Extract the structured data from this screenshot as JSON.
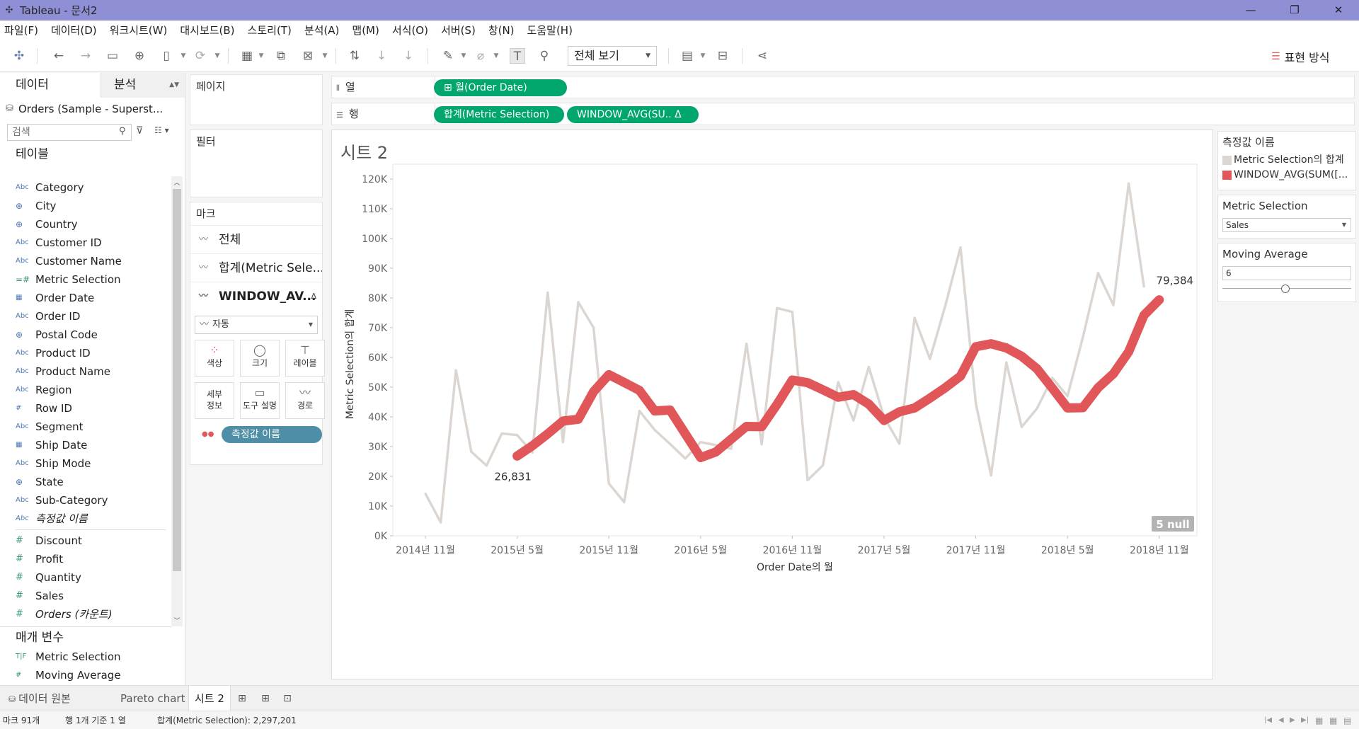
{
  "window": {
    "title": "Tableau - 문서2",
    "controls": [
      "minimize-icon",
      "restore-icon",
      "close-icon"
    ]
  },
  "menu": [
    "파일(F)",
    "데이터(D)",
    "워크시트(W)",
    "대시보드(B)",
    "스토리(T)",
    "분석(A)",
    "맵(M)",
    "서식(O)",
    "서버(S)",
    "창(N)",
    "도움말(H)"
  ],
  "toolbar": {
    "fit_label": "전체 보기",
    "show_me_label": "표현 방식"
  },
  "data_pane": {
    "tab_data": "데이터",
    "tab_analysis": "분석",
    "datasource": "Orders (Sample - Superst...",
    "search_placeholder": "검색",
    "tables_title": "테이블",
    "dimensions": [
      {
        "icon": "Abc",
        "name": "Category"
      },
      {
        "icon": "⊕",
        "name": "City"
      },
      {
        "icon": "⊕",
        "name": "Country"
      },
      {
        "icon": "Abc",
        "name": "Customer ID"
      },
      {
        "icon": "Abc",
        "name": "Customer Name"
      },
      {
        "icon": "=#",
        "name": "Metric Selection"
      },
      {
        "icon": "▦",
        "name": "Order Date"
      },
      {
        "icon": "Abc",
        "name": "Order ID"
      },
      {
        "icon": "⊕",
        "name": "Postal Code"
      },
      {
        "icon": "Abc",
        "name": "Product ID"
      },
      {
        "icon": "Abc",
        "name": "Product Name"
      },
      {
        "icon": "Abc",
        "name": "Region"
      },
      {
        "icon": "#",
        "name": "Row ID"
      },
      {
        "icon": "Abc",
        "name": "Segment"
      },
      {
        "icon": "▦",
        "name": "Ship Date"
      },
      {
        "icon": "Abc",
        "name": "Ship Mode"
      },
      {
        "icon": "⊕",
        "name": "State"
      },
      {
        "icon": "Abc",
        "name": "Sub-Category"
      },
      {
        "icon": "Abc",
        "name": "측정값 이름",
        "italic": true
      }
    ],
    "measures": [
      {
        "icon": "#",
        "name": "Discount"
      },
      {
        "icon": "#",
        "name": "Profit"
      },
      {
        "icon": "#",
        "name": "Quantity"
      },
      {
        "icon": "#",
        "name": "Sales"
      },
      {
        "icon": "#",
        "name": "Orders (카운트)",
        "italic": true
      }
    ],
    "params_title": "매개 변수",
    "params": [
      {
        "icon": "T|F",
        "name": "Metric Selection"
      },
      {
        "icon": "#",
        "name": "Moving Average"
      }
    ]
  },
  "cards": {
    "pages_title": "페이지",
    "filters_title": "필터",
    "marks_title": "마크",
    "marks_rows": [
      {
        "label": "전체"
      },
      {
        "label": "합계(Metric Sele..."
      },
      {
        "label": "WINDOW_AV...",
        "delta": "Δ"
      }
    ],
    "mark_type": "자동",
    "mark_buttons": [
      {
        "icon": "●●",
        "label": "색상"
      },
      {
        "icon": "◯",
        "label": "크기"
      },
      {
        "icon": "T",
        "label": "레이블"
      },
      {
        "icon": "",
        "label": "세부\n정보"
      },
      {
        "icon": "▭",
        "label": "도구 설명"
      },
      {
        "icon": "〰",
        "label": "경로"
      }
    ],
    "measure_names_pill": "측정값 이름"
  },
  "shelves": {
    "columns_label": "열",
    "rows_label": "행",
    "columns_pill": "⊞ 월(Order Date)",
    "rows_pills": [
      "합계(Metric Selection)",
      "WINDOW_AVG(SU..  Δ"
    ]
  },
  "sheet": {
    "title": "시트 2",
    "null_badge": "5 null"
  },
  "chart_data": {
    "type": "line",
    "xlabel": "Order Date의 월",
    "ylabel": "Metric Selection의 합계",
    "ylim": [
      0,
      125000
    ],
    "yticks": [
      "0K",
      "10K",
      "20K",
      "30K",
      "40K",
      "50K",
      "60K",
      "70K",
      "80K",
      "90K",
      "100K",
      "110K",
      "120K"
    ],
    "xticks": [
      "2014년 11월",
      "2015년 5월",
      "2015년 11월",
      "2016년 5월",
      "2016년 11월",
      "2017년 5월",
      "2017년 11월",
      "2018년 5월",
      "2018년 11월"
    ],
    "x_start": "2014-11",
    "series": [
      {
        "name": "Metric Selection의 합계",
        "color": "#dcd6d2",
        "values": [
          14200,
          4500,
          55700,
          28300,
          23600,
          34400,
          33900,
          28000,
          81800,
          31500,
          78600,
          70000,
          17600,
          11300,
          42000,
          35600,
          30900,
          26000,
          31500,
          30500,
          29300,
          64600,
          30800,
          76600,
          75300,
          18700,
          23700,
          51700,
          38800,
          56800,
          39900,
          31000,
          73300,
          59500,
          77300,
          97000,
          44600,
          20300,
          58300,
          36600,
          42800,
          53100,
          47000,
          66700,
          88400,
          77600,
          118500,
          83800
        ]
      },
      {
        "name": "WINDOW_AVG(SUM([...",
        "color": "#e15759",
        "start_index": 6,
        "values": [
          26831,
          30300,
          34300,
          38600,
          39200,
          48500,
          54200,
          51600,
          48900,
          42000,
          42300,
          34300,
          26300,
          28200,
          32500,
          36800,
          36700,
          44200,
          52400,
          51500,
          49100,
          46600,
          47500,
          44300,
          38800,
          41700,
          43000,
          46300,
          49800,
          53700,
          63600,
          64600,
          63200,
          60400,
          56200,
          49700,
          43000,
          43100,
          49800,
          54500,
          61900,
          74200,
          79384
        ]
      }
    ],
    "annotations": [
      {
        "label": "26,831"
      },
      {
        "label": "79,384"
      }
    ]
  },
  "legend": {
    "title": "측정값 이름",
    "items": [
      {
        "label": "Metric Selection의 합계",
        "color": "#dcd6d2"
      },
      {
        "label": "WINDOW_AVG(SUM([...",
        "color": "#e15759"
      }
    ]
  },
  "param_cards": {
    "metric_title": "Metric Selection",
    "metric_value": "Sales",
    "ma_title": "Moving Average",
    "ma_value": "6",
    "ma_slider_fraction": 0.48
  },
  "sheet_tabs": {
    "source": "데이터 원본",
    "tabs": [
      "Pareto chart",
      "시트 2"
    ]
  },
  "status": {
    "marks": "마크 91개",
    "rows": "행 1개 기준 1 열",
    "sum": "합계(Metric Selection): 2,297,201"
  }
}
